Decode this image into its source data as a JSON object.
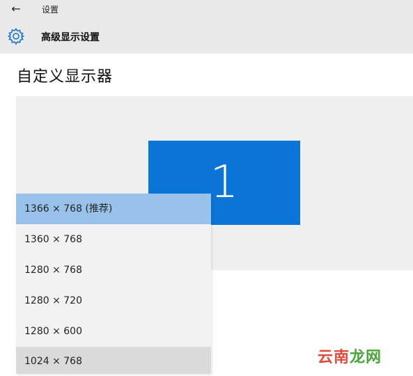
{
  "titlebar": {
    "back_label": "←",
    "title": "设置"
  },
  "header": {
    "icon": "gear-icon",
    "title": "高级显示设置"
  },
  "page": {
    "title": "自定义显示器"
  },
  "monitor": {
    "number": "1",
    "color": "#0a75d6"
  },
  "resolution_dropdown": {
    "options": [
      "1366 × 768 (推荐)",
      "1360 × 768",
      "1280 × 768",
      "1280 × 720",
      "1280 × 600",
      "1024 × 768"
    ],
    "selected": "1366 × 768 (推荐)",
    "hovered": "1024 × 768"
  },
  "watermark": {
    "part1": "云南",
    "part2": "龙网"
  },
  "colors": {
    "titlebar_bg": "#e9e9e9",
    "selected_bg": "#99c2eb",
    "hover_bg": "#dadada"
  }
}
